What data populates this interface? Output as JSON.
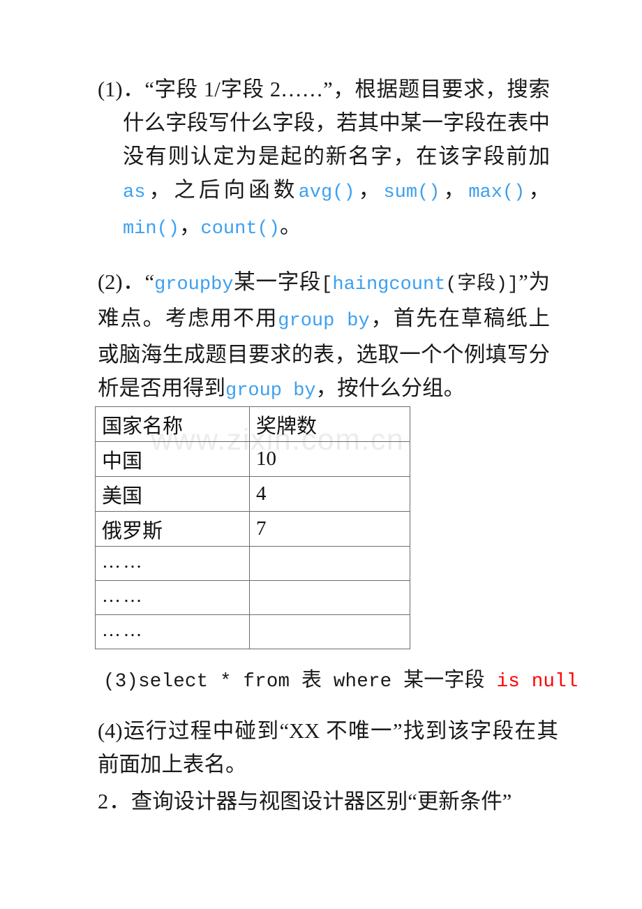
{
  "document": {
    "watermark": "www.zixin.com.cn",
    "colors": {
      "keyword_blue": "#3da0ef",
      "keyword_red": "#fb0505",
      "text_black": "#1a1a1a",
      "table_border": "#6c6c6c",
      "watermark_gray": "#ececec",
      "page_background": "#ffffff"
    }
  },
  "paragraph1": {
    "marker": "(1)．",
    "seg_a": "“字段 1/字段 2……”，根据题目要求，搜索什么字段写什么字段，若其中某一字段在表中没有则认定为是起的新名字，在该字段前加",
    "kw_as": "as",
    "seg_b": "，之后向函数",
    "kw_avg": "avg()",
    "comma1": "，",
    "kw_sum": "sum()",
    "comma2": "，",
    "kw_max": "max()",
    "comma3": "，",
    "kw_min": "min()",
    "comma4": "，",
    "kw_count": "count()",
    "period": "。"
  },
  "paragraph2": {
    "marker": "(2)．",
    "quote_open": "“",
    "kw_groupby": "groupby",
    "seg_a": "某一字段",
    "bracket_open": "[",
    "kw_haingcount": "haingcount",
    "seg_b": "(字段)",
    "bracket_close": "]",
    "quote_close": "”",
    "seg_c": "为难点。考虑用不用",
    "kw_group_by_1": "group by",
    "seg_d": "，首先在草稿纸上或脑海生成题目要求的表，选取一个个例填写分析是否用得到",
    "kw_group_by_2": "group by",
    "seg_e": "，按什么分组。"
  },
  "table": {
    "headers": [
      "国家名称",
      "奖牌数"
    ],
    "rows": [
      {
        "country": "中国",
        "medals": "10",
        "type": "text"
      },
      {
        "country": "美国",
        "medals": "4",
        "type": "text"
      },
      {
        "country": "俄罗斯",
        "medals": "7",
        "type": "text"
      },
      {
        "country": "……",
        "medals": "",
        "type": "dots"
      },
      {
        "country": "……",
        "medals": "",
        "type": "dots"
      },
      {
        "country": "……",
        "medals": "",
        "type": "dots"
      }
    ]
  },
  "paragraph3": {
    "marker": "(3)",
    "sql_a": "select * from ",
    "cjk_table": "表",
    "sql_b": " where ",
    "cjk_field": "某一字段",
    "kw_is_null": " is null"
  },
  "paragraph4": {
    "marker": "(4)",
    "text": "运行过程中碰到“XX 不唯一”找到该字段在其前面加上表名。"
  },
  "section2": {
    "number": "2．",
    "title": "查询设计器与视图设计器区别“更新条件”"
  }
}
